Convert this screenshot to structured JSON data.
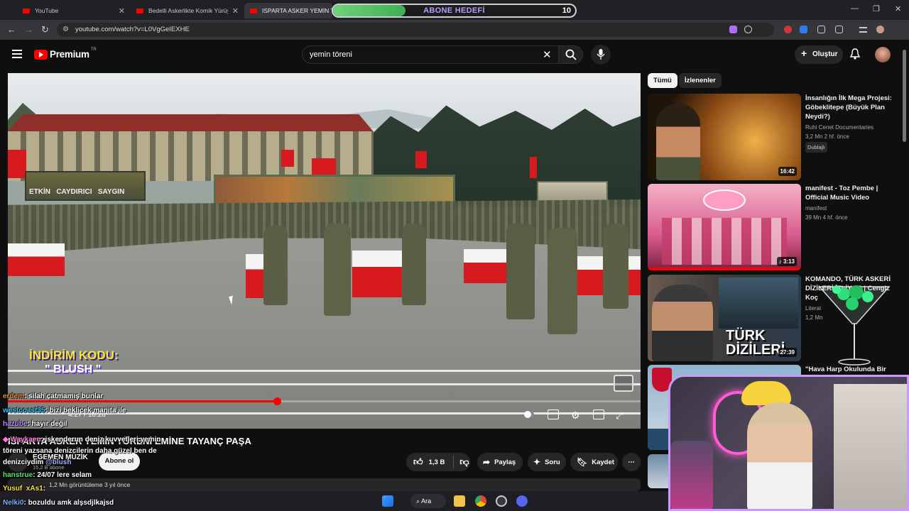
{
  "browser": {
    "tabs": [
      {
        "title": "YouTube",
        "active": false
      },
      {
        "title": "Bedelli Askerlikte Komik Yürüyü",
        "active": false
      },
      {
        "title": "ISPARTA ASKER YEMİN TÖR",
        "active": true
      }
    ],
    "url": "youtube.com/watch?v=L0VgGeIEXHE"
  },
  "overlay": {
    "goal_label": "ABONE HEDEFİ",
    "goal_value": "10",
    "goal_progress": 0.3
  },
  "youtube": {
    "logo_text": "Premium",
    "logo_region": "TR",
    "search_value": "yemin töreni",
    "create_label": "Oluştur"
  },
  "video": {
    "promo_line1": "İNDİRİM KODU:",
    "promo_line2": "\" BLUSH \"",
    "time_current": "4:27",
    "time_total": "10:28",
    "progress": 0.425,
    "banner_text": "ETKİN   CAYDIRICI   SAYGIN",
    "title": "ISPARTA ASKER YEMİN TÖRENİ EMİNE TAYANÇ PAŞA",
    "channel": "EGEMEN MÜZİK",
    "subscribers": "15,2 B abone",
    "subscribe_label": "Abone ol",
    "like_count": "1,3 B",
    "share_label": "Paylaş",
    "ask_label": "Soru",
    "save_label": "Kaydet",
    "below_meta": "1,2 Mn görüntüleme  3 yıl önce"
  },
  "sidebar": {
    "chips": [
      "Tümü",
      "İzlenenler"
    ],
    "videos": [
      {
        "title": "İnsanlığın İlk Mega Projesi: Göbeklitepe (Büyük Plan Neydi?)",
        "channel": "Ruhi Cenet Documentaries",
        "meta": "3,2 Mn  2 hf. önce",
        "badge": "Dublajlı",
        "duration": "16:42"
      },
      {
        "title": "manifest - Toz Pembe | Official Music Video",
        "channel": "manifest",
        "meta": "39 Mn  4 hf. önce",
        "badge": "",
        "duration": "3:13"
      },
      {
        "title": "KOMANDO, TÜRK ASKERİ DİZİLERİ İZLİYOR | Cengiz Koç",
        "channel": "Literat",
        "meta": "1,2 Mn",
        "badge": "",
        "duration": "27:39"
      },
      {
        "title": "\"Hava Harp Okulunda Bir",
        "channel": "",
        "meta": "",
        "badge": "",
        "duration": ""
      }
    ],
    "thumb3_text": "TÜRK DİZİLERİ"
  },
  "chat": [
    {
      "user": "erdem",
      "text": ": silah çatmamış bunlar",
      "color": "#f08a2c"
    },
    {
      "user": "westcoast35",
      "text": ": bizi beklicek manita ile",
      "color": "#34c3ff"
    },
    {
      "user": "hazube",
      "text": ": hayır değil",
      "color": "#b78bff"
    },
    {
      "user": "Waykaen",
      "text": ": iskenderun deniz kuvvetleri yemin töreni yazsana denizcilerin daha güzel ben de denizciydim",
      "color": "#ff7ad9"
    },
    {
      "user": "hanstrue",
      "text": ": 24/07 lere selam",
      "color": "#5ee27a"
    },
    {
      "user": "Yusuf_xAs1",
      "text": ": ",
      "color": "#f5e342"
    },
    {
      "user": "Nelki0",
      "text": ": bozuldu amk alşsdjlkajsd",
      "color": "#7fb3ff"
    }
  ],
  "chat_mention": "@blush",
  "taskbar": {
    "search_label": "Ara"
  }
}
